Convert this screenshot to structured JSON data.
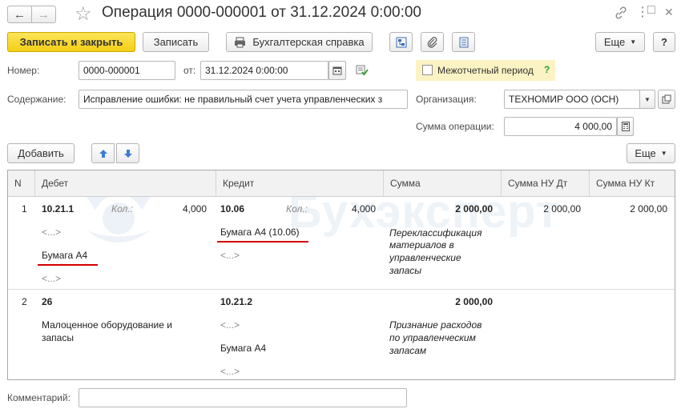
{
  "window": {
    "title": "Операция 0000-000001 от 31.12.2024 0:00:00",
    "nav_back": "←",
    "nav_forward": "→",
    "star": "☆",
    "link_icon": "link-icon",
    "menu": "⋮",
    "restore": "□",
    "close": "✕"
  },
  "toolbar": {
    "save_close": "Записать и закрыть",
    "save": "Записать",
    "report": "Бухгалтерская справка",
    "more": "Еще",
    "help": "?"
  },
  "header": {
    "number_label": "Номер:",
    "number_value": "0000-000001",
    "from_label": "от:",
    "date_value": "31.12.2024  0:00:00",
    "interperiod_label": "Межотчетный период",
    "interperiod_help": "?",
    "content_label": "Содержание:",
    "content_value": "Исправление ошибки: не правильный счет учета управленческих з",
    "org_label": "Организация:",
    "org_value": "ТЕХНОМИР ООО (ОСН)",
    "sum_label": "Сумма операции:",
    "sum_value": "4 000,00"
  },
  "table_toolbar": {
    "add": "Добавить",
    "more": "Еще"
  },
  "watermark": "Бухэксперт",
  "columns": [
    "N",
    "Дебет",
    "Кредит",
    "Сумма",
    "Сумма НУ Дт",
    "Сумма НУ Кт"
  ],
  "rows": [
    {
      "n": "1",
      "debit_account": "10.21.1",
      "debit_qty_label": "Кол.:",
      "debit_qty": "4,000",
      "debit_sub1": "<...>",
      "debit_sub2": "Бумага А4",
      "debit_sub3": "<...>",
      "credit_account": "10.06",
      "credit_qty_label": "Кол.:",
      "credit_qty": "4,000",
      "credit_sub1": "Бумага А4 (10.06)",
      "credit_sub2": "<...>",
      "sum": "2 000,00",
      "comment_l1": "Переклассификация",
      "comment_l2": "материалов в",
      "comment_l3": "управленческие",
      "comment_l4": "запасы",
      "nu_dt": "2 000,00",
      "nu_kt": "2 000,00"
    },
    {
      "n": "2",
      "debit_account": "26",
      "debit_sub1_l1": "Малоценное оборудование и",
      "debit_sub1_l2": "запасы",
      "credit_account": "10.21.2",
      "credit_sub1": "<...>",
      "credit_sub2": "Бумага А4",
      "credit_sub3": "<...>",
      "sum": "2 000,00",
      "comment_l1": "Признание расходов",
      "comment_l2": "по управленческим",
      "comment_l3": "запасам"
    }
  ],
  "footer": {
    "comment_label": "Комментарий:",
    "comment_value": ""
  }
}
